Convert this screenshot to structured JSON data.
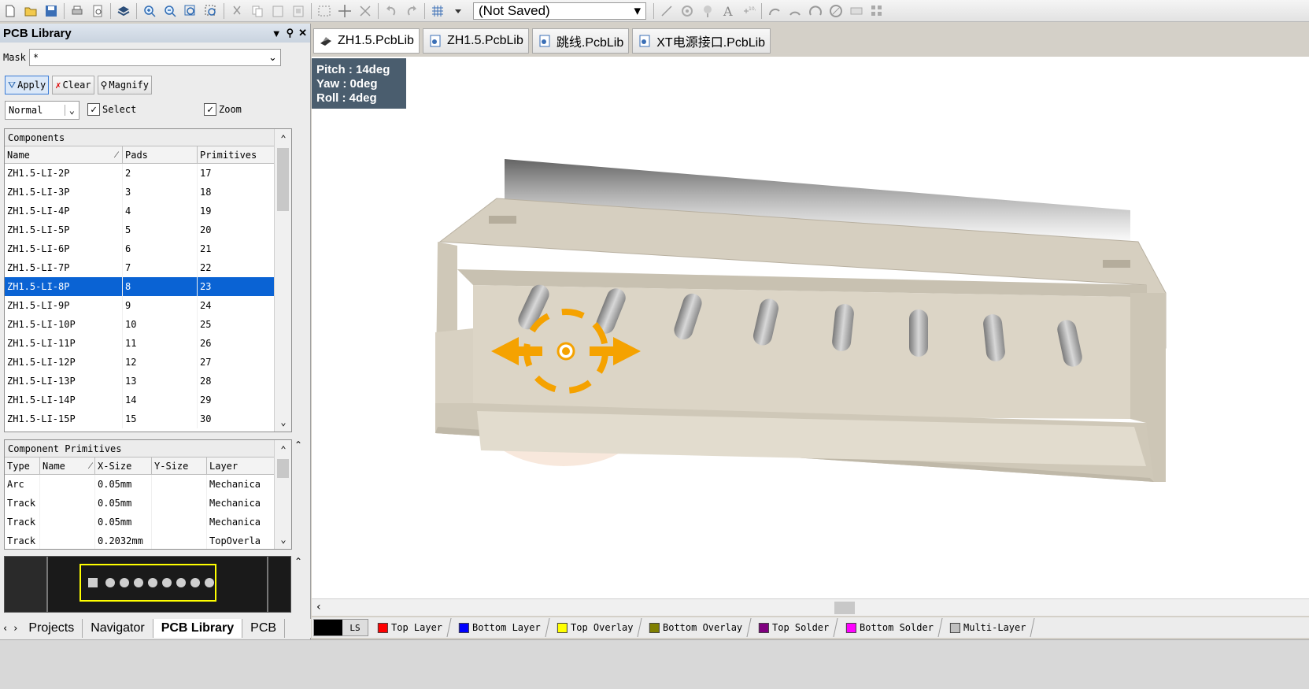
{
  "toolbar": {
    "icons": [
      "new-file",
      "open-folder",
      "save",
      "print",
      "print-preview",
      "3d-layers",
      "zoom-in",
      "zoom-out",
      "zoom-fit",
      "zoom-area",
      "cut",
      "copy",
      "paste",
      "paste-special",
      "select-rect",
      "move",
      "move-selection",
      "undo",
      "redo",
      "grid",
      "view-state",
      "line",
      "pad",
      "via",
      "text",
      "coordinate",
      "arc-center",
      "arc-edge",
      "arc-any",
      "full-circle",
      "fill",
      "array-paste"
    ],
    "view_state": "(Not Saved)"
  },
  "panel": {
    "title": "PCB Library",
    "mask_label": "Mask",
    "mask_value": "*",
    "apply": "Apply",
    "clear": "Clear",
    "magnify": "Magnify",
    "mode": "Normal",
    "select_label": "Select",
    "zoom_label": "Zoom"
  },
  "components": {
    "caption": "Components",
    "headers": [
      "Name",
      "Pads",
      "Primitives"
    ],
    "rows": [
      [
        "ZH1.5-LI-2P",
        "2",
        "17"
      ],
      [
        "ZH1.5-LI-3P",
        "3",
        "18"
      ],
      [
        "ZH1.5-LI-4P",
        "4",
        "19"
      ],
      [
        "ZH1.5-LI-5P",
        "5",
        "20"
      ],
      [
        "ZH1.5-LI-6P",
        "6",
        "21"
      ],
      [
        "ZH1.5-LI-7P",
        "7",
        "22"
      ],
      [
        "ZH1.5-LI-8P",
        "8",
        "23"
      ],
      [
        "ZH1.5-LI-9P",
        "9",
        "24"
      ],
      [
        "ZH1.5-LI-10P",
        "10",
        "25"
      ],
      [
        "ZH1.5-LI-11P",
        "11",
        "26"
      ],
      [
        "ZH1.5-LI-12P",
        "12",
        "27"
      ],
      [
        "ZH1.5-LI-13P",
        "13",
        "28"
      ],
      [
        "ZH1.5-LI-14P",
        "14",
        "29"
      ],
      [
        "ZH1.5-LI-15P",
        "15",
        "30"
      ]
    ],
    "selected_index": 6
  },
  "primitives": {
    "caption": "Component Primitives",
    "headers": [
      "Type",
      "Name",
      "X-Size",
      "Y-Size",
      "Layer"
    ],
    "rows": [
      [
        "Arc",
        "",
        "0.05mm",
        "",
        "Mechanica"
      ],
      [
        "Track",
        "",
        "0.05mm",
        "",
        "Mechanica"
      ],
      [
        "Track",
        "",
        "0.05mm",
        "",
        "Mechanica"
      ],
      [
        "Track",
        "",
        "0.2032mm",
        "",
        "TopOverla"
      ]
    ]
  },
  "bottom_tabs": [
    "Projects",
    "Navigator",
    "PCB Library",
    "PCB"
  ],
  "doc_tabs": [
    "ZH1.5.PcbLib",
    "ZH1.5.PcbLib",
    "跳线.PcbLib",
    "XT电源接口.PcbLib"
  ],
  "orientation": {
    "pitch": "Pitch : 14deg",
    "yaw": "Yaw : 0deg",
    "roll": "Roll : 4deg"
  },
  "layers": {
    "ls": "LS",
    "items": [
      {
        "name": "Top Layer",
        "color": "#ff0000"
      },
      {
        "name": "Bottom Layer",
        "color": "#0000ff"
      },
      {
        "name": "Top Overlay",
        "color": "#ffff00"
      },
      {
        "name": "Bottom Overlay",
        "color": "#808000"
      },
      {
        "name": "Top Solder",
        "color": "#800080"
      },
      {
        "name": "Bottom Solder",
        "color": "#ff00ff"
      },
      {
        "name": "Multi-Layer",
        "color": "#c0c0c0"
      }
    ]
  },
  "colors": {
    "selection": "#0a63d4",
    "connector_body": "#d4cdbe",
    "gizmo": "#f5a200"
  }
}
